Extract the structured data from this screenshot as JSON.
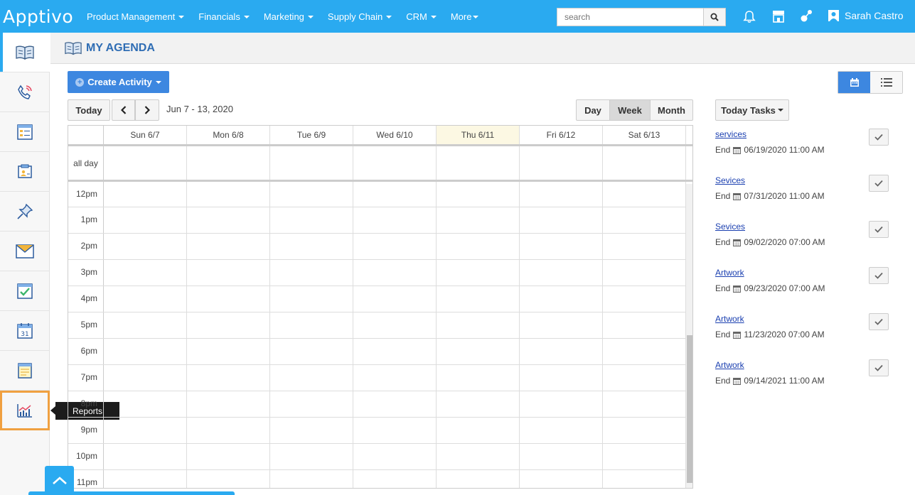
{
  "app": {
    "logo": "Apptivo"
  },
  "nav": {
    "items": [
      {
        "label": "Product Management"
      },
      {
        "label": "Financials"
      },
      {
        "label": "Marketing"
      },
      {
        "label": "Supply Chain"
      },
      {
        "label": "CRM"
      },
      {
        "label": "More"
      }
    ]
  },
  "search": {
    "placeholder": "search"
  },
  "user": {
    "name": "Sarah Castro"
  },
  "sidebar": {
    "tooltip": "Reports",
    "items": [
      {
        "icon": "agenda-book-icon"
      },
      {
        "icon": "phone-call-icon"
      },
      {
        "icon": "notes-list-icon"
      },
      {
        "icon": "contact-card-icon"
      },
      {
        "icon": "pushpin-icon"
      },
      {
        "icon": "envelope-icon"
      },
      {
        "icon": "task-check-icon"
      },
      {
        "icon": "calendar-31-icon"
      },
      {
        "icon": "notepad-icon"
      },
      {
        "icon": "reports-chart-icon"
      }
    ]
  },
  "page": {
    "title": "MY AGENDA"
  },
  "toolbar": {
    "create_label": "Create Activity",
    "today_label": "Today",
    "date_range": "Jun 7 - 13, 2020",
    "day_label": "Day",
    "week_label": "Week",
    "month_label": "Month",
    "selected_view": "Week"
  },
  "calendar": {
    "days": [
      "Sun 6/7",
      "Mon 6/8",
      "Tue 6/9",
      "Wed 6/10",
      "Thu 6/11",
      "Fri 6/12",
      "Sat 6/13"
    ],
    "today": "Thu 6/11",
    "allday_label": "all day",
    "hours": [
      "12pm",
      "1pm",
      "2pm",
      "3pm",
      "4pm",
      "5pm",
      "6pm",
      "7pm",
      "8pm",
      "9pm",
      "10pm",
      "11pm"
    ]
  },
  "tasks": {
    "header": "Today Tasks",
    "end_prefix": "End",
    "items": [
      {
        "title": "services",
        "end": "06/19/2020 11:00 AM"
      },
      {
        "title": "Sevices",
        "end": "07/31/2020 11:00 AM"
      },
      {
        "title": "Sevices",
        "end": "09/02/2020 07:00 AM"
      },
      {
        "title": "Artwork",
        "end": "09/23/2020 07:00 AM"
      },
      {
        "title": "Artwork",
        "end": "11/23/2020 07:00 AM"
      },
      {
        "title": "Artwork",
        "end": "09/14/2021 11:00 AM"
      }
    ]
  },
  "colors": {
    "accent": "#2aaaf0",
    "primary_button": "#3d87e0",
    "title": "#2f6db4",
    "today_bg": "#fcf8e3"
  }
}
